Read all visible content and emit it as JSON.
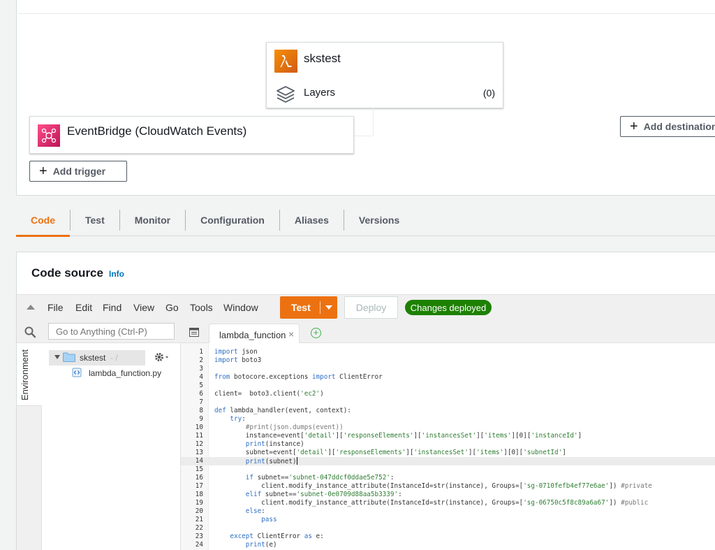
{
  "designer": {
    "function_name": "skstest",
    "layers_label": "Layers",
    "layers_count": "(0)",
    "trigger_name": "EventBridge (CloudWatch Events)",
    "add_trigger_label": "Add trigger",
    "add_destination_label": "Add destination"
  },
  "tabs": [
    {
      "label": "Code",
      "active": true
    },
    {
      "label": "Test",
      "active": false
    },
    {
      "label": "Monitor",
      "active": false
    },
    {
      "label": "Configuration",
      "active": false
    },
    {
      "label": "Aliases",
      "active": false
    },
    {
      "label": "Versions",
      "active": false
    }
  ],
  "code_source": {
    "title": "Code source",
    "info_label": "Info"
  },
  "ide": {
    "menu": [
      "File",
      "Edit",
      "Find",
      "View",
      "Go",
      "Tools",
      "Window"
    ],
    "test_label": "Test",
    "deploy_label": "Deploy",
    "status_badge": "Changes deployed",
    "search_placeholder": "Go to Anything (Ctrl-P)",
    "open_tab": "lambda_function",
    "environment_label": "Environment",
    "tree_root": "skstest",
    "tree_root_path": "- /",
    "tree_file": "lambda_function.py",
    "active_line": 14,
    "code_lines": [
      "import json",
      "import boto3",
      "",
      "from botocore.exceptions import ClientError",
      "",
      "client=  boto3.client('ec2')",
      "",
      "def lambda_handler(event, context):",
      "    try:",
      "        #print(json.dumps(event))",
      "        instance=event['detail']['responseElements']['instancesSet']['items'][0]['instanceId']",
      "        print(instance)",
      "        subnet=event['detail']['responseElements']['instancesSet']['items'][0]['subnetId']",
      "        print(subnet)",
      "",
      "        if subnet=='subnet-047ddcf0ddae5e752':",
      "            client.modify_instance_attribute(InstanceId=str(instance), Groups=['sg-0710fefb4ef77e6ae']) #private",
      "        elif subnet=='subnet-0e0709d88aa5b3339':",
      "            client.modify_instance_attribute(InstanceId=str(instance), Groups=['sg-06750c5f8c89a6a67']) #public",
      "        else:",
      "            pass",
      "",
      "    except ClientError as e:",
      "        print(e)"
    ]
  },
  "colors": {
    "accent": "#ec7211",
    "link": "#0073bb",
    "success": "#1d8102",
    "keyword": "#2f6fc5",
    "string": "#2e7d32"
  }
}
